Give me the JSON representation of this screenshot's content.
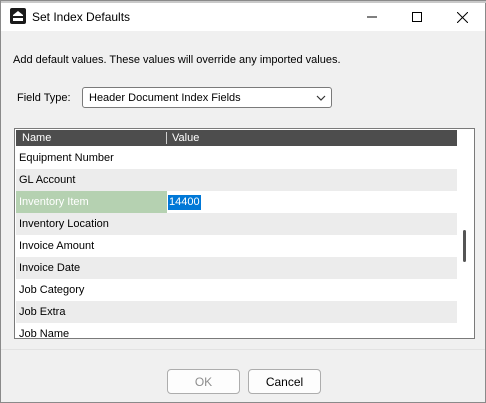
{
  "window": {
    "title": "Set Index Defaults"
  },
  "intro_text": "Add default values. These values will override any imported values.",
  "field_type": {
    "label": "Field Type:",
    "selected": "Header Document Index Fields"
  },
  "grid": {
    "columns": [
      "Name",
      "Value"
    ],
    "rows": [
      {
        "name": "Equipment Number",
        "value": ""
      },
      {
        "name": "GL Account",
        "value": ""
      },
      {
        "name": "Inventory Item",
        "value": "14400",
        "selected": true
      },
      {
        "name": "Inventory Location",
        "value": ""
      },
      {
        "name": "Invoice Amount",
        "value": ""
      },
      {
        "name": "Invoice Date",
        "value": ""
      },
      {
        "name": "Job Category",
        "value": ""
      },
      {
        "name": "Job Extra",
        "value": ""
      },
      {
        "name": "Job Name",
        "value": ""
      }
    ]
  },
  "buttons": {
    "ok": "OK",
    "cancel": "Cancel"
  },
  "colors": {
    "header_bg": "#4d4d4d",
    "selected_name_bg": "#b5d1b1",
    "selected_value_bg": "#0078d7"
  }
}
